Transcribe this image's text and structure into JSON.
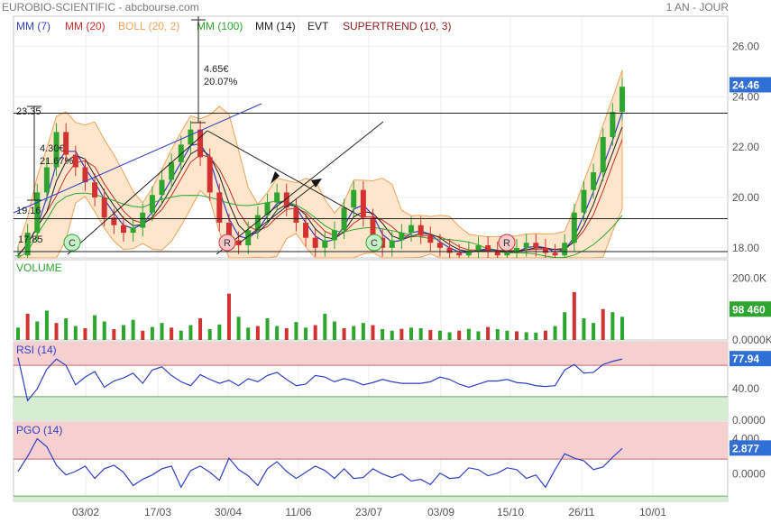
{
  "header": {
    "title": "EUROBIO-SCIENTIFIC - abcbourse.com",
    "period": "1 AN - JOUR"
  },
  "legend": [
    {
      "label": "MM (7)",
      "color": "#2f3fc4"
    },
    {
      "label": "MM (20)",
      "color": "#cc2b2b"
    },
    {
      "label": "BOLL (20, 2)",
      "color": "#f0a35a"
    },
    {
      "label": "MM (100)",
      "color": "#2ea52e"
    },
    {
      "label": "MM (14)",
      "color": "#222222"
    },
    {
      "label": "EVT",
      "color": "#222222"
    },
    {
      "label": "SUPERTREND (10, 3)",
      "color": "#8b1a1a"
    }
  ],
  "chart_data": [
    {
      "type": "candlestick",
      "panel": "price",
      "x_dates": [
        "03/02",
        "17/03",
        "30/04",
        "11/06",
        "23/07",
        "03/09",
        "15/10",
        "26/11",
        "10/01"
      ],
      "ylim": [
        17.6,
        27.2
      ],
      "y_ticks": [
        "26.00",
        "24.00",
        "22.00",
        "20.00",
        "18.00"
      ],
      "last_value": "24.46",
      "annotations": [
        {
          "text": "23.35"
        },
        {
          "text": "19.16"
        },
        {
          "text": "17.85"
        },
        {
          "text": "4.30€"
        },
        {
          "text": "21.67%"
        },
        {
          "text": "4.65€"
        },
        {
          "text": "20.07%"
        }
      ],
      "markers": [
        "C",
        "R",
        "C",
        "R"
      ],
      "close_series": [
        17.7,
        18.6,
        20.2,
        21.2,
        22.6,
        21.7,
        21.2,
        20.6,
        20.0,
        19.2,
        18.9,
        18.6,
        18.8,
        19.4,
        20.1,
        20.7,
        21.4,
        22.1,
        22.7,
        21.6,
        20.2,
        19.0,
        18.3,
        18.1,
        18.7,
        19.3,
        19.8,
        20.2,
        19.6,
        19.0,
        18.4,
        18.0,
        18.3,
        18.7,
        19.6,
        20.3,
        19.2,
        18.4,
        18.0,
        18.3,
        18.6,
        18.9,
        18.5,
        18.2,
        18.0,
        17.8,
        17.7,
        17.9,
        18.1,
        17.9,
        17.7,
        17.8,
        18.0,
        18.2,
        18.0,
        17.8,
        17.7,
        18.2,
        19.4,
        20.3,
        21.0,
        22.4,
        23.4,
        24.4
      ]
    },
    {
      "type": "bar",
      "panel": "volume",
      "title": "VOLUME",
      "ylim": [
        0,
        260
      ],
      "y_ticks": [
        "200.0K",
        "0.0000K"
      ],
      "last_value": "98 460",
      "values": [
        40,
        85,
        60,
        95,
        55,
        70,
        45,
        38,
        80,
        60,
        35,
        48,
        65,
        30,
        42,
        55,
        40,
        30,
        48,
        70,
        35,
        50,
        150,
        75,
        40,
        45,
        70,
        45,
        38,
        58,
        40,
        48,
        85,
        60,
        38,
        45,
        55,
        48,
        35,
        30,
        36,
        40,
        38,
        32,
        30,
        25,
        30,
        36,
        28,
        42,
        35,
        30,
        28,
        25,
        24,
        30,
        45,
        90,
        155,
        70,
        55,
        100,
        90,
        75
      ]
    },
    {
      "type": "line",
      "panel": "rsi",
      "title": "RSI (14)",
      "ylim": [
        0,
        100
      ],
      "y_ticks": [
        "40.00",
        "0.0000"
      ],
      "levels": [
        70,
        30
      ],
      "last_value": "77.94",
      "values": [
        80,
        25,
        40,
        65,
        78,
        70,
        45,
        55,
        62,
        42,
        50,
        54,
        60,
        47,
        64,
        68,
        57,
        49,
        44,
        58,
        52,
        47,
        51,
        44,
        53,
        49,
        57,
        61,
        52,
        44,
        46,
        57,
        55,
        49,
        53,
        50,
        45,
        48,
        52,
        49,
        47,
        47,
        47,
        49,
        55,
        52,
        46,
        42,
        46,
        50,
        50,
        52,
        48,
        47,
        44,
        43,
        44,
        64,
        71,
        60,
        61,
        71,
        75,
        78
      ]
    },
    {
      "type": "line",
      "panel": "pgo",
      "title": "PGO (14)",
      "ylim": [
        -3.1,
        5.9
      ],
      "y_ticks": [
        "4.000",
        "0.0000"
      ],
      "levels": [
        1.7,
        -2.5
      ],
      "last_value": "2.877",
      "values": [
        0.3,
        2.0,
        4.0,
        3.1,
        1.0,
        -0.1,
        0.3,
        0.9,
        -0.5,
        0.6,
        1.0,
        0.2,
        -1.3,
        -0.6,
        -0.1,
        0.6,
        0.9,
        -1.5,
        0.4,
        0.9,
        0.2,
        -0.7,
        1.8,
        0.5,
        -0.2,
        -1.3,
        0.6,
        1.4,
        0.3,
        -0.5,
        0.2,
        0.9,
        0.4,
        -0.5,
        0.6,
        -0.5,
        -0.4,
        0.6,
        0.0,
        -0.4,
        0.0,
        -0.8,
        -0.6,
        -1.2,
        0.1,
        -0.5,
        -0.4,
        0.7,
        0.5,
        -0.2,
        0.1,
        0.7,
        0.5,
        -0.5,
        -0.1,
        -1.5,
        0.5,
        2.3,
        1.8,
        1.5,
        0.5,
        0.8,
        1.9,
        2.9
      ]
    }
  ]
}
